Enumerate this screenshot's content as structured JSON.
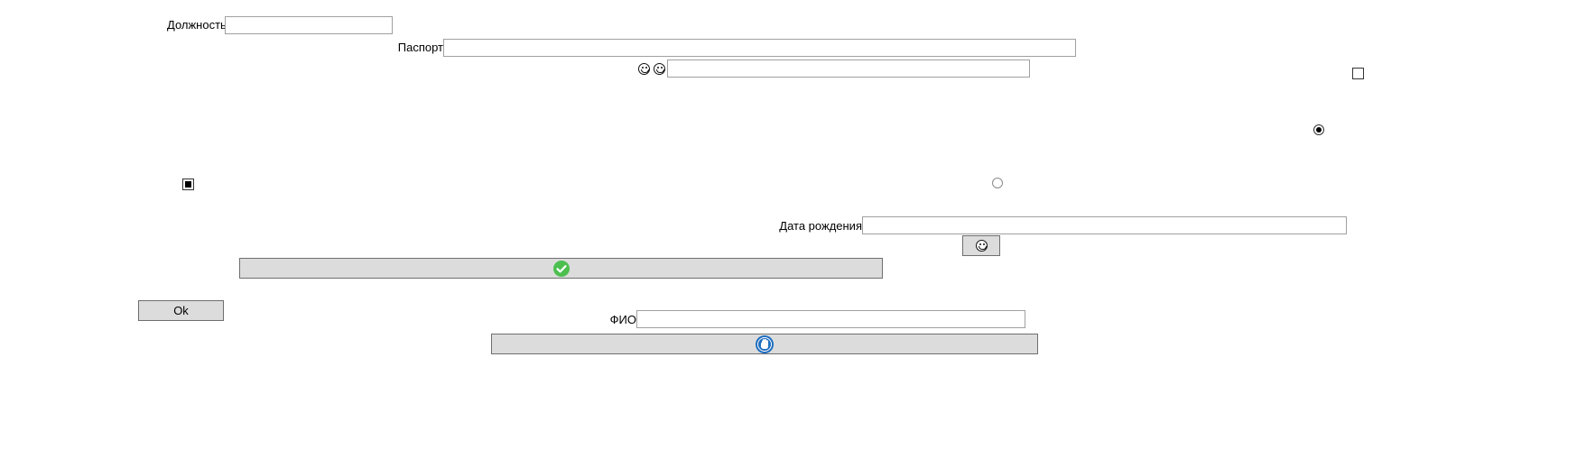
{
  "form": {
    "position_label": "Должность",
    "position_value": "",
    "passport_label": "Паспорт",
    "passport_value": "",
    "emoji_field_value": "",
    "birth_date_label": "Дата рождения",
    "birth_date_value": "",
    "full_name_label": "ФИО",
    "full_name_value": ""
  },
  "controls": {
    "checkbox_top_checked": false,
    "checkbox_left_checked": true,
    "radio_top_selected": true,
    "radio_mid_selected": false
  },
  "buttons": {
    "ok_label": "Ok",
    "check_icon_color": "#4cbf4f",
    "hand_icon_color": "#1f6fc0"
  },
  "icons": {
    "emoji_1": "grinning-face-icon",
    "emoji_2": "smiling-face-icon",
    "emoji_button": "grinning-face-icon",
    "wide_button_1": "green-check-circle-icon",
    "wide_button_2": "blue-hand-circle-icon"
  }
}
